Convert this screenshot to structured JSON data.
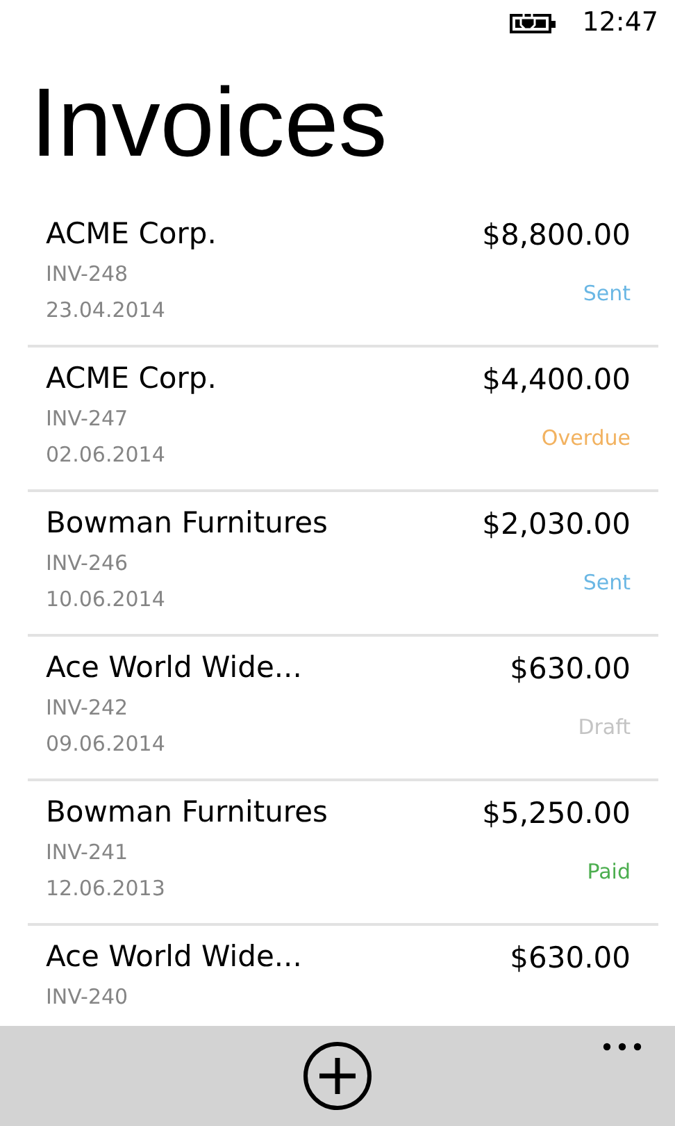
{
  "status_bar": {
    "time": "12:47"
  },
  "title": "Invoices",
  "invoices": [
    {
      "customer": "ACME Corp.",
      "number": "INV-248",
      "date": "23.04.2014",
      "amount": "$8,800.00",
      "status": "Sent",
      "kind": "sent"
    },
    {
      "customer": "ACME Corp.",
      "number": "INV-247",
      "date": "02.06.2014",
      "amount": "$4,400.00",
      "status": "Overdue",
      "kind": "overdue"
    },
    {
      "customer": "Bowman Furnitures",
      "number": "INV-246",
      "date": "10.06.2014",
      "amount": "$2,030.00",
      "status": "Sent",
      "kind": "sent"
    },
    {
      "customer": "Ace World Wide...",
      "number": "INV-242",
      "date": "09.06.2014",
      "amount": "$630.00",
      "status": "Draft",
      "kind": "draft"
    },
    {
      "customer": "Bowman Furnitures",
      "number": "INV-241",
      "date": "12.06.2013",
      "amount": "$5,250.00",
      "status": "Paid",
      "kind": "paid"
    },
    {
      "customer": "Ace World Wide...",
      "number": "INV-240",
      "amount": "$630.00"
    }
  ]
}
